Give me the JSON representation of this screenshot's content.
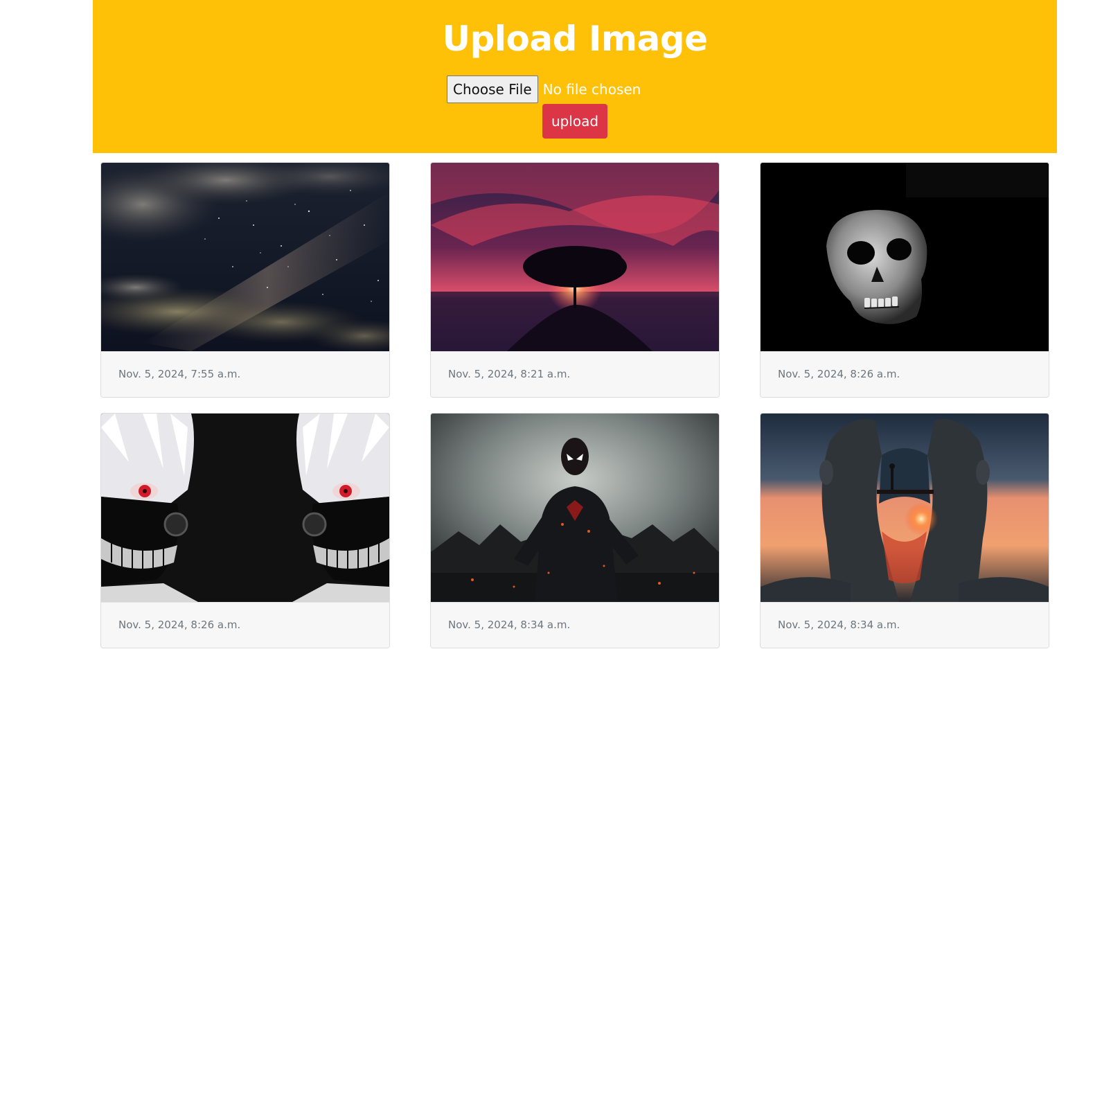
{
  "header": {
    "title": "Upload Image",
    "choose_file_label": "Choose File",
    "file_status": "No file chosen",
    "upload_label": "upload",
    "background_color": "#ffc107",
    "upload_button_color": "#dc3545"
  },
  "gallery": {
    "cards": [
      {
        "date": "Nov. 5, 2024, 7:55 a.m.",
        "image": "starry-night-sky-image"
      },
      {
        "date": "Nov. 5, 2024, 8:21 a.m.",
        "image": "tree-sunset-image"
      },
      {
        "date": "Nov. 5, 2024, 8:26 a.m.",
        "image": "skull-image"
      },
      {
        "date": "Nov. 5, 2024, 8:26 a.m.",
        "image": "anime-masked-character-image"
      },
      {
        "date": "Nov. 5, 2024, 8:34 a.m.",
        "image": "dark-spider-hero-image"
      },
      {
        "date": "Nov. 5, 2024, 8:34 a.m.",
        "image": "surreal-head-sunset-image"
      }
    ]
  }
}
